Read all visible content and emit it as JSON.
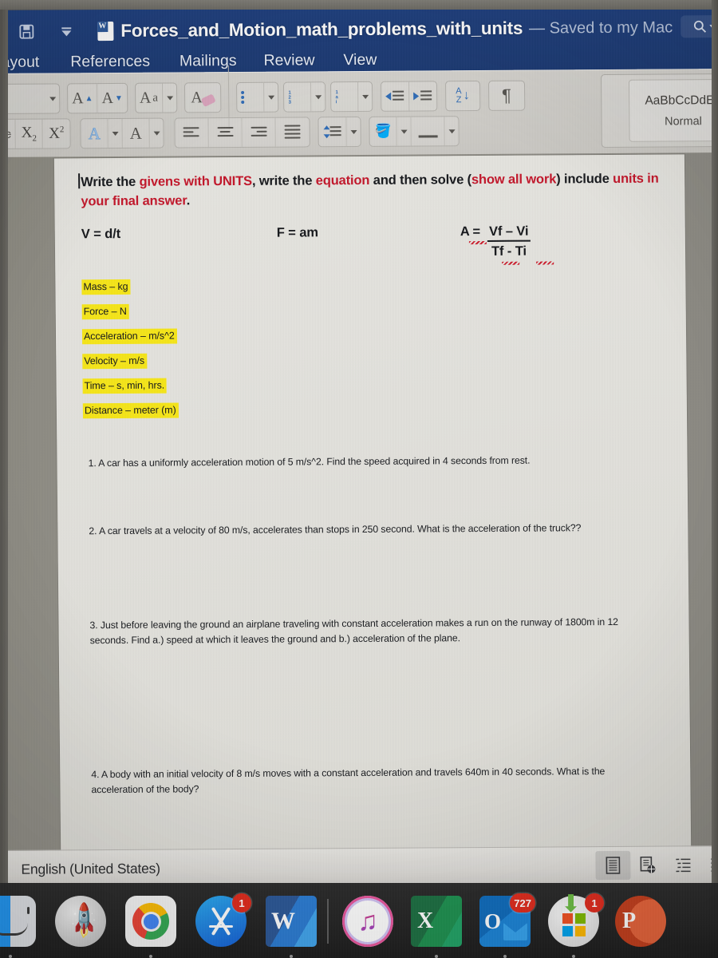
{
  "titlebar": {
    "save_icon": "save-icon",
    "chevron_icon": "chevron-down-icon",
    "app_icon": "word-document-icon",
    "app_icon_letter": "W",
    "document_title": "Forces_and_Motion_math_problems_with_units",
    "save_state": "— Saved to my Mac",
    "search_icon": "search-icon",
    "search_caret_icon": "chevron-down-icon"
  },
  "ribbon_tabs": [
    {
      "label": "Layout"
    },
    {
      "label": "References"
    },
    {
      "label": "Mailings"
    },
    {
      "label": "Review"
    },
    {
      "label": "View"
    }
  ],
  "ribbon": {
    "row1": [
      {
        "name": "font-size-dropdown",
        "icon": "chevron-down-icon",
        "label": ""
      },
      {
        "name": "grow-font-button",
        "icon": "grow-font-icon",
        "label": "A"
      },
      {
        "name": "shrink-font-button",
        "icon": "shrink-font-icon",
        "label": "A"
      },
      {
        "name": "change-case-button",
        "icon": "change-case-icon",
        "label": "Aa"
      },
      {
        "name": "text-highlight-color-button",
        "icon": "highlighter-icon",
        "label": "A"
      },
      {
        "name": "bulleted-list-button",
        "icon": "bulleted-list-icon",
        "label": ""
      },
      {
        "name": "numbered-list-button",
        "icon": "numbered-list-icon",
        "label": ""
      },
      {
        "name": "multilevel-list-button",
        "icon": "multilevel-list-icon",
        "label": ""
      },
      {
        "name": "decrease-indent-button",
        "icon": "decrease-indent-icon",
        "label": ""
      },
      {
        "name": "increase-indent-button",
        "icon": "increase-indent-icon",
        "label": ""
      },
      {
        "name": "sort-button",
        "icon": "sort-az-icon",
        "label": "A Z"
      },
      {
        "name": "show-formatting-button",
        "icon": "pilcrow-icon",
        "label": "¶"
      }
    ],
    "row2": [
      {
        "name": "strikethrough-button",
        "icon": "strikethrough-icon",
        "label": "abc"
      },
      {
        "name": "subscript-button",
        "icon": "subscript-icon",
        "label": "X2"
      },
      {
        "name": "superscript-button",
        "icon": "superscript-icon",
        "label": "X2"
      },
      {
        "name": "text-effects-button",
        "icon": "text-effects-icon",
        "label": "A"
      },
      {
        "name": "font-color-button",
        "icon": "font-color-icon",
        "label": "A"
      },
      {
        "name": "align-left-button",
        "icon": "align-left-icon",
        "label": ""
      },
      {
        "name": "align-center-button",
        "icon": "align-center-icon",
        "label": ""
      },
      {
        "name": "align-right-button",
        "icon": "align-right-icon",
        "label": ""
      },
      {
        "name": "justify-button",
        "icon": "justify-icon",
        "label": ""
      },
      {
        "name": "line-spacing-button",
        "icon": "line-spacing-icon",
        "label": ""
      },
      {
        "name": "shading-button",
        "icon": "paint-bucket-icon",
        "label": ""
      },
      {
        "name": "borders-button",
        "icon": "borders-icon",
        "label": ""
      }
    ],
    "style_gallery": {
      "sample_text": "AaBbCcDdEe",
      "style_name": "Normal"
    }
  },
  "document": {
    "heading": {
      "segments": [
        {
          "text": "Write the ",
          "color": "black"
        },
        {
          "text": "givens with UNITS",
          "color": "red"
        },
        {
          "text": ", write the ",
          "color": "black"
        },
        {
          "text": "equation",
          "color": "red"
        },
        {
          "text": " and then solve (",
          "color": "black"
        },
        {
          "text": "show all work",
          "color": "red"
        },
        {
          "text": ") include ",
          "color": "black"
        },
        {
          "text": "units in your final answer",
          "color": "red"
        },
        {
          "text": ".",
          "color": "black"
        }
      ],
      "plain": "Write the givens with UNITS, write the equation and then solve (show all work) include units in your final answer."
    },
    "formulas": {
      "velocity": "V = d/t",
      "force": "F = am",
      "acceleration_label": "A =",
      "acceleration_numerator": "Vf – Vi",
      "acceleration_denominator": "Tf - Ti"
    },
    "units_list": [
      "Mass – kg",
      "Force – N",
      "Acceleration – m/s^2",
      "Velocity – m/s",
      "Time – s, min, hrs.",
      "Distance – meter (m)"
    ],
    "highlight_color": "#f5e519",
    "red_color": "#c2162a",
    "problems": [
      "1.  A car has a uniformly acceleration motion of 5 m/s^2.  Find the speed acquired in 4 seconds from rest.",
      "2.  A car travels at a velocity of 80 m/s, accelerates than stops in 250 second. What is the acceleration of the truck??",
      "3.  Just before leaving the ground an airplane traveling with constant acceleration makes a run on the runway of 1800m in 12 seconds.  Find a.) speed at which it leaves the ground and b.) acceleration of the plane.",
      "4.   A body with an initial velocity of 8 m/s moves with a constant acceleration and travels 640m in 40 seconds.  What is the acceleration of the body?"
    ]
  },
  "statusbar": {
    "language": "English (United States)",
    "view_buttons": [
      {
        "name": "print-layout-view-button",
        "icon": "print-layout-icon",
        "active": true
      },
      {
        "name": "web-layout-view-button",
        "icon": "web-layout-icon",
        "active": false
      },
      {
        "name": "outline-view-button",
        "icon": "outline-view-icon",
        "active": false
      },
      {
        "name": "draft-view-button",
        "icon": "draft-view-icon",
        "active": false
      }
    ]
  },
  "dock": {
    "items": [
      {
        "name": "dock-item-finder",
        "label": "Finder",
        "icon": "finder-icon",
        "badge": "",
        "running": true
      },
      {
        "name": "dock-item-launchpad",
        "label": "Launchpad",
        "icon": "launchpad-rocket-icon",
        "badge": "",
        "running": false
      },
      {
        "name": "dock-item-chrome",
        "label": "Google Chrome",
        "icon": "chrome-icon",
        "badge": "",
        "running": true
      },
      {
        "name": "dock-item-app-store",
        "label": "App Store",
        "icon": "app-store-icon",
        "badge": "1",
        "running": false
      },
      {
        "name": "dock-item-word",
        "label": "Microsoft Word",
        "icon": "word-icon",
        "badge": "",
        "running": true
      },
      {
        "name": "dock-item-itunes",
        "label": "iTunes",
        "icon": "itunes-music-note-icon",
        "badge": "",
        "running": false
      },
      {
        "name": "dock-item-excel",
        "label": "Microsoft Excel",
        "icon": "excel-icon",
        "badge": "",
        "running": true
      },
      {
        "name": "dock-item-outlook",
        "label": "Microsoft Outlook",
        "icon": "outlook-icon",
        "badge": "727",
        "running": true
      },
      {
        "name": "dock-item-ms-autoupdate",
        "label": "Microsoft AutoUpdate",
        "icon": "microsoft-autoupdate-icon",
        "badge": "1",
        "running": true
      },
      {
        "name": "dock-item-powerpoint",
        "label": "Microsoft PowerPoint",
        "icon": "powerpoint-icon",
        "badge": "",
        "running": false
      }
    ]
  },
  "colors": {
    "titlebar_blue": "#1d3c78",
    "ribbon_gray": "#cfcdc8",
    "page_white": "#e3e2dd",
    "desktop_gray": "#8e8c85",
    "dock_black": "#242424",
    "badge_red": "#e02b1d"
  }
}
